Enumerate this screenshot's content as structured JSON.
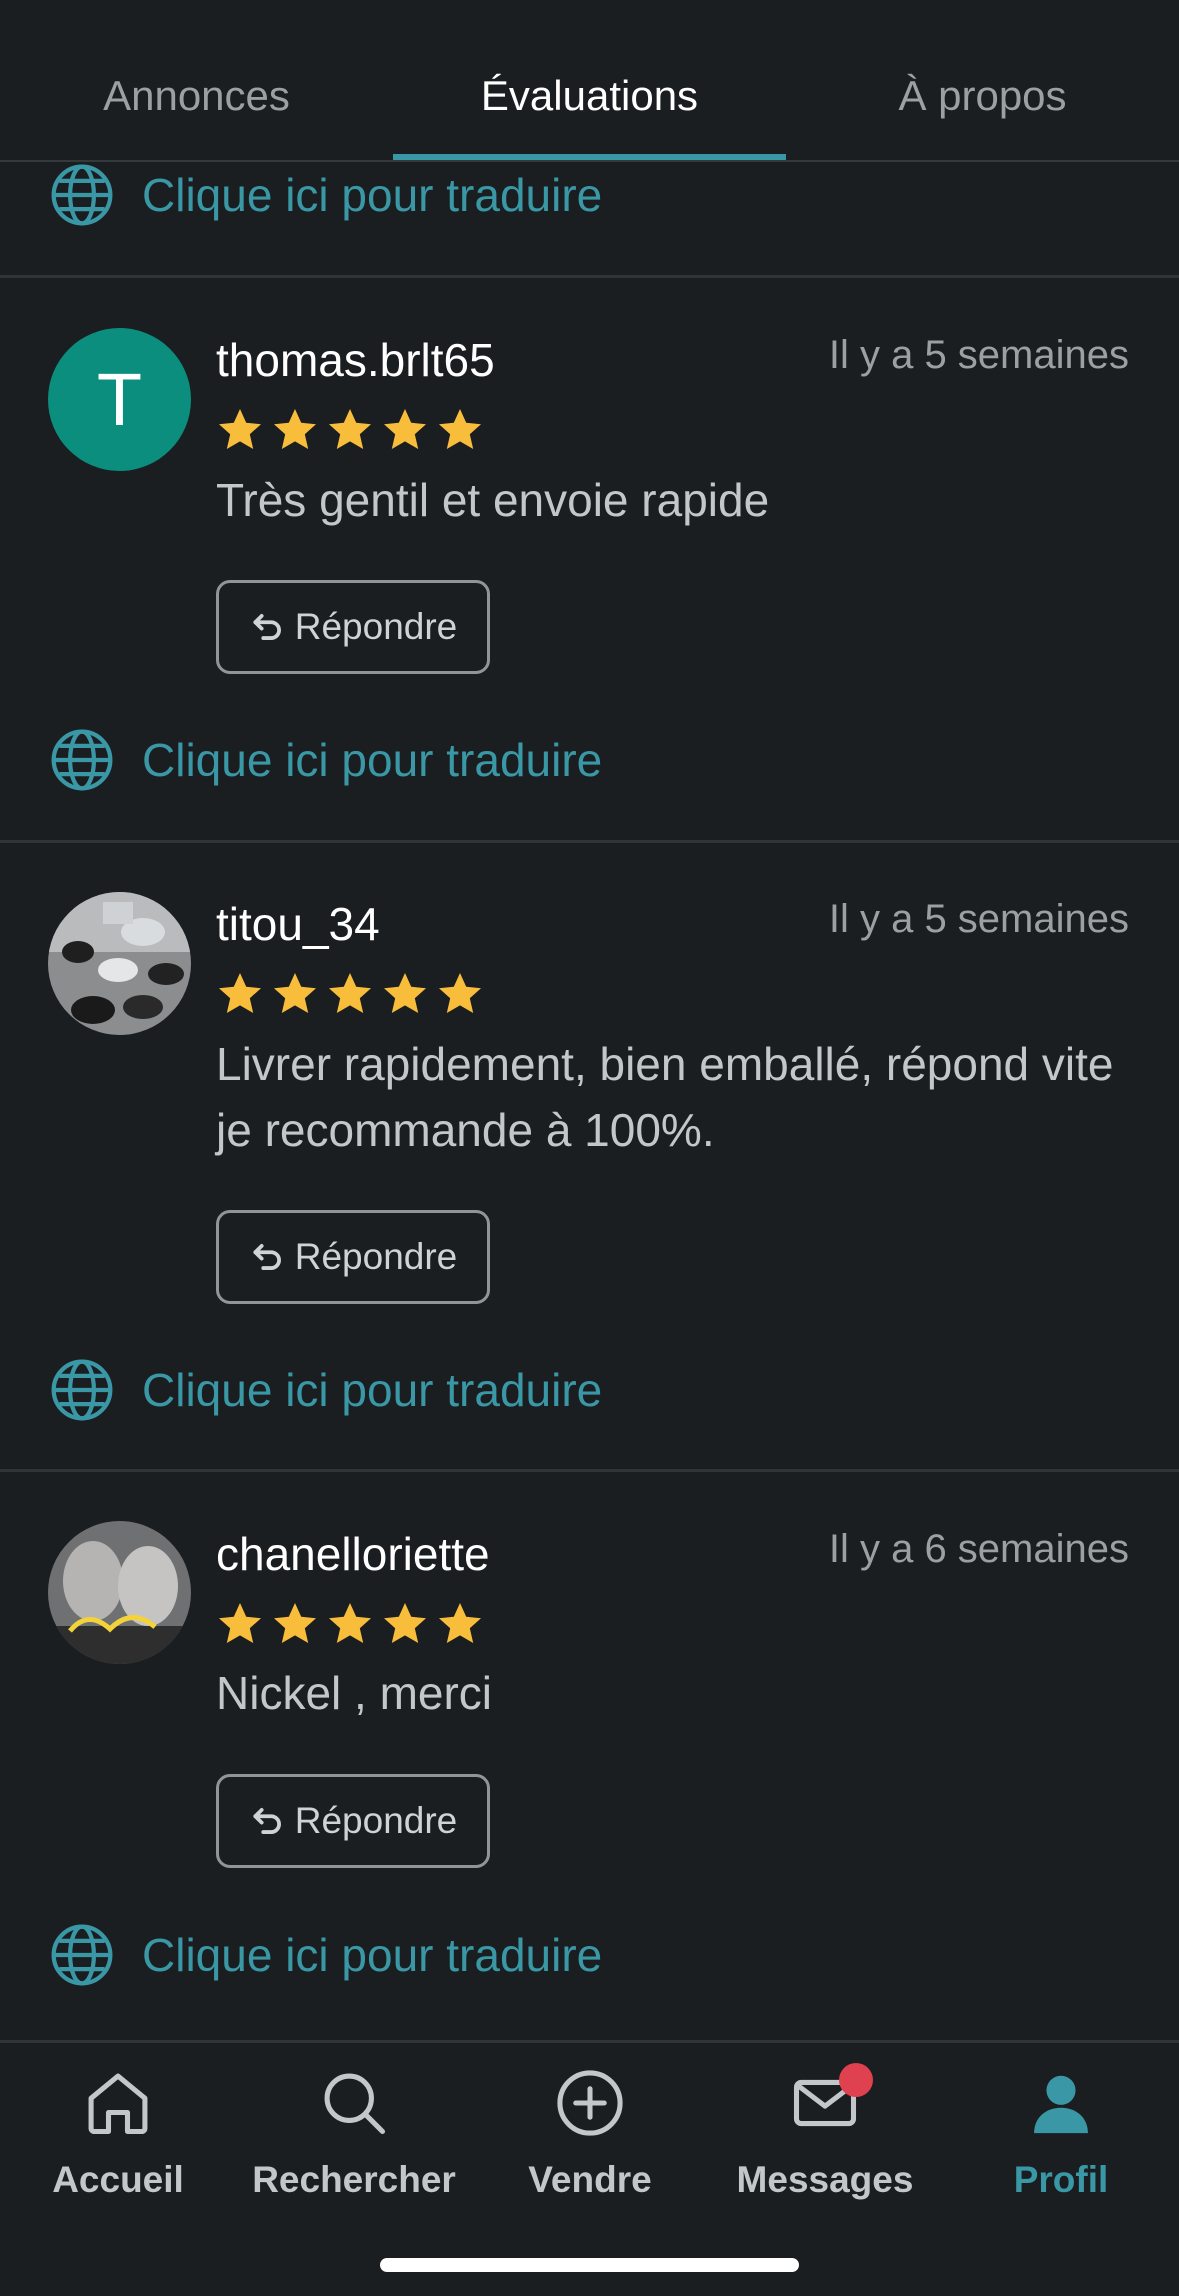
{
  "tabs": [
    {
      "label": "Annonces",
      "active": false
    },
    {
      "label": "Évaluations",
      "active": true
    },
    {
      "label": "À propos",
      "active": false
    }
  ],
  "translate_label": "Clique ici pour traduire",
  "reply_label": "Répondre",
  "reviews": [
    {
      "username": "thomas.brlt65",
      "avatar_letter": "T",
      "avatar_type": "letter",
      "date": "Il y a 5 semaines",
      "rating": 5,
      "comment": "Très gentil et envoie rapide"
    },
    {
      "username": "titou_34",
      "avatar_type": "photo",
      "date": "Il y a 5 semaines",
      "rating": 5,
      "comment": "Livrer rapidement, bien emballé, répond vite je recommande à 100%."
    },
    {
      "username": "chanelloriette",
      "avatar_type": "photo",
      "date": "Il y a 6 semaines",
      "rating": 5,
      "comment": "Nickel , merci"
    }
  ],
  "bottom_nav": [
    {
      "label": "Accueil",
      "icon": "home-icon",
      "active": false
    },
    {
      "label": "Rechercher",
      "icon": "search-icon",
      "active": false
    },
    {
      "label": "Vendre",
      "icon": "plus-circle-icon",
      "active": false
    },
    {
      "label": "Messages",
      "icon": "mail-icon",
      "active": false,
      "badge": true
    },
    {
      "label": "Profil",
      "icon": "profile-icon",
      "active": true
    }
  ],
  "colors": {
    "background": "#1b1e20",
    "accent": "#3a97a6",
    "star": "#f9bd3c",
    "avatar_letter_bg": "#0b8e7e",
    "badge": "#e0414e"
  }
}
